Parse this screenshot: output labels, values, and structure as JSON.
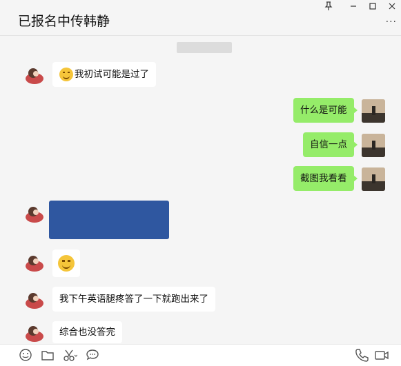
{
  "header": {
    "title": "已报名中传韩静",
    "pin_icon": "pin-icon",
    "minimize_icon": "minimize-icon",
    "maximize_icon": "maximize-icon",
    "close_icon": "close-icon",
    "more_icon": "more-icon"
  },
  "timestamp": "",
  "messages": [
    {
      "side": "left",
      "type": "text",
      "text": "我初试可能是过了",
      "has_emoji": true
    },
    {
      "side": "right",
      "type": "text",
      "text": "什么是可能"
    },
    {
      "side": "right",
      "type": "text",
      "text": "自信一点"
    },
    {
      "side": "right",
      "type": "text",
      "text": "截图我看看"
    },
    {
      "side": "left",
      "type": "image",
      "rows": [
        {
          "label": "",
          "value": ""
        },
        {
          "label": "",
          "value": ""
        },
        {
          "label": "",
          "value": ""
        },
        {
          "label": "",
          "value": ""
        }
      ]
    },
    {
      "side": "left",
      "type": "sticker"
    },
    {
      "side": "left",
      "type": "text",
      "text": "我下午英语腿疼答了一下就跑出来了"
    },
    {
      "side": "left",
      "type": "text",
      "text": "综合也没答完"
    }
  ],
  "toolbar": {
    "emoji_icon": "emoji-icon",
    "folder_icon": "folder-icon",
    "scissors_icon": "scissors-icon",
    "chat_history_icon": "chat-history-icon",
    "phone_icon": "phone-icon",
    "video_icon": "video-icon"
  },
  "colors": {
    "sent_bubble": "#95ec69",
    "received_bubble": "#ffffff",
    "background": "#f5f5f5"
  }
}
